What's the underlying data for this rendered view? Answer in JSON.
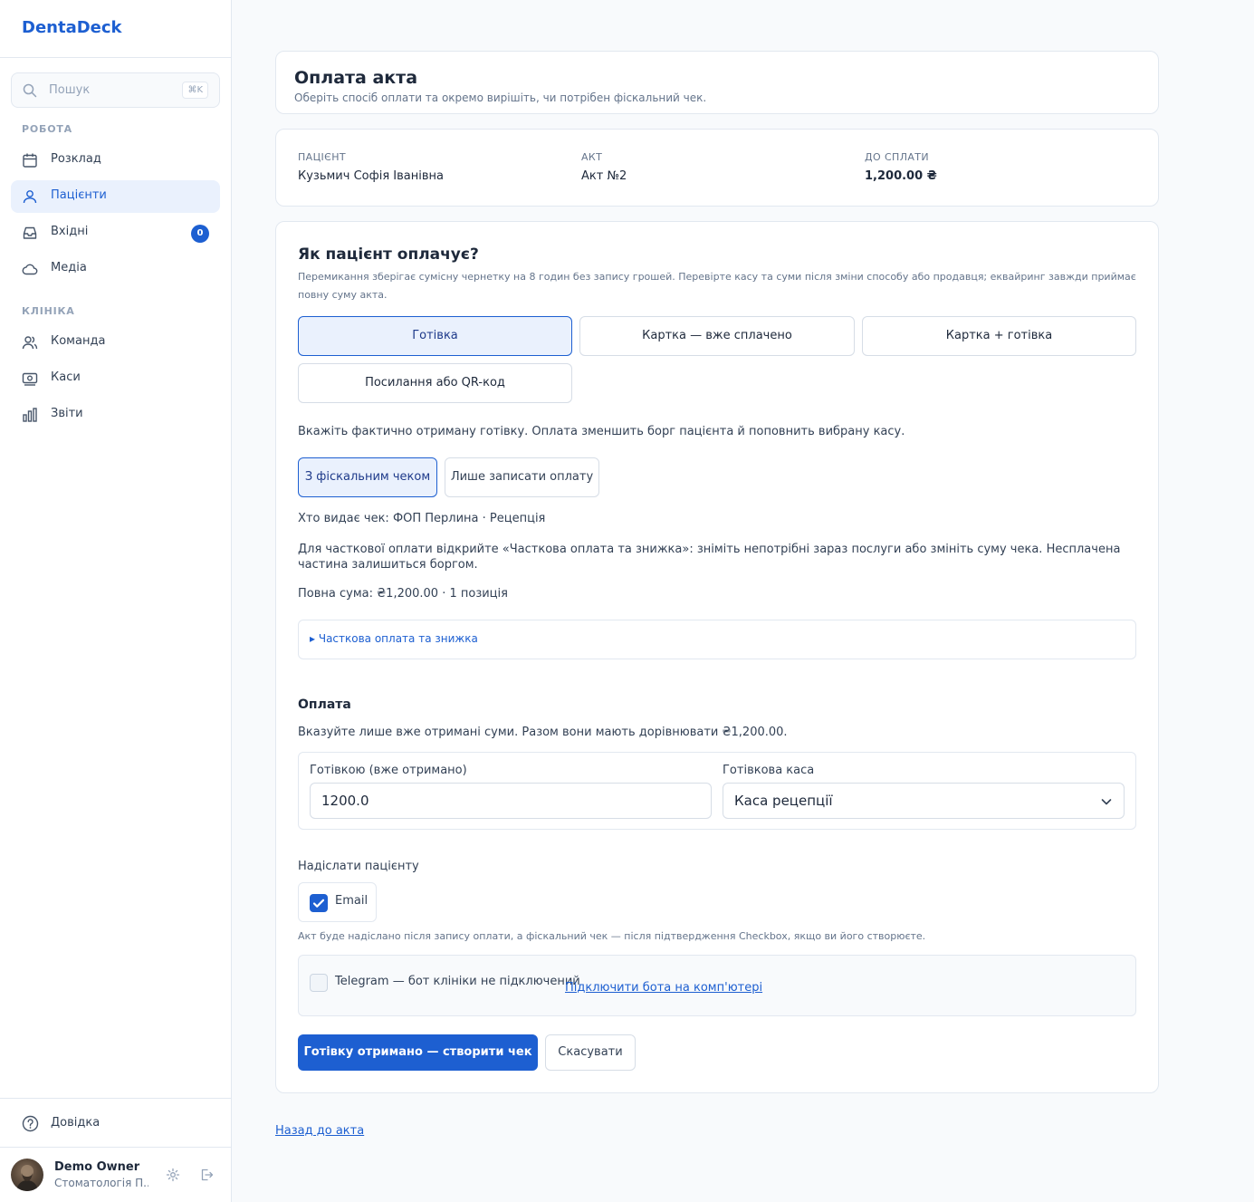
{
  "app": {
    "brand": "DentaDeck"
  },
  "sidebar": {
    "search": {
      "placeholder": "Пошук",
      "shortcut": "⌘K"
    },
    "groups": [
      {
        "label": "РОБОТА"
      },
      {
        "label": "КЛІНІКА"
      }
    ],
    "items": [
      {
        "label": "Розклад",
        "icon": "calendar-icon"
      },
      {
        "label": "Пацієнти",
        "icon": "users-icon",
        "active": true
      },
      {
        "label": "Вхідні",
        "icon": "inbox-icon",
        "badge": "0"
      },
      {
        "label": "Медіа",
        "icon": "cloud-icon"
      },
      {
        "label": "Команда",
        "icon": "team-icon"
      },
      {
        "label": "Каси",
        "icon": "cash-register-icon"
      },
      {
        "label": "Звіти",
        "icon": "bar-chart-icon"
      }
    ],
    "help": {
      "label": "Довідка",
      "icon": "help-circle-icon"
    },
    "user": {
      "name": "Demo Owner",
      "org": "Стоматологія П..."
    }
  },
  "header": {
    "title": "Оплата акта",
    "subtitle": "Оберіть спосіб оплати та окремо вирішіть, чи потрібен фіскальний чек."
  },
  "summary": {
    "patient_label": "ПАЦІЄНТ",
    "patient_value": "Кузьмич Софія Іванівна",
    "act_label": "АКТ",
    "act_value": "Акт №2",
    "due_label": "ДО СПЛАТИ",
    "due_value": "1,200.00 ₴"
  },
  "method": {
    "title": "Як пацієнт оплачує?",
    "hint": "Перемикання зберігає сумісну чернетку на 8 годин без запису грошей. Перевірте касу та суми після зміни способу або продавця; еквайринг завжди приймає повну суму акта.",
    "options": [
      {
        "label": "Готівка",
        "selected": true
      },
      {
        "label": "Картка — вже сплачено",
        "selected": false
      },
      {
        "label": "Картка + готівка",
        "selected": false
      },
      {
        "label": "Посилання або QR-код",
        "selected": false
      }
    ],
    "cash_note": "Вкажіть фактично отриману готівку. Оплата зменшить борг пацієнта й поповнить вибрану касу.",
    "receipt_options": [
      {
        "label": "З фіскальним чеком",
        "selected": true
      },
      {
        "label": "Лише записати оплату",
        "selected": false
      }
    ],
    "issuer": "Хто видає чек: ФОП Перлина · Рецепція",
    "partial_note": "Для часткової оплати відкрийте «Часткова оплата та знижка»: зніміть непотрібні зараз послуги або змініть суму чека. Несплачена частина залишиться боргом.",
    "full_sum": "Повна сума: ₴1,200.00 · 1 позиція",
    "details_label": "Часткова оплата та знижка"
  },
  "payment": {
    "title": "Оплата",
    "hint": "Вказуйте лише вже отримані суми. Разом вони мають дорівнювати ₴1,200.00.",
    "cash_label": "Готівкою (вже отримано)",
    "cash_value": "1200.0",
    "register_label": "Готівкова каса",
    "register_value": "Каса рецепції"
  },
  "send": {
    "title": "Надіслати пацієнту",
    "email_label": "Email",
    "email_checked": true,
    "note": "Акт буде надіслано після запису оплати, а фіскальний чек — після підтвердження Checkbox, якщо ви його створюєте.",
    "telegram_label": "Telegram — бот клініки не підключений",
    "telegram_checked": false,
    "telegram_link": "Підключити бота на комп'ютері"
  },
  "actions": {
    "primary": "Готівку отримано — створити чек",
    "cancel": "Скасувати",
    "back": "Назад до акта"
  },
  "colors": {
    "accent": "#1d5fd1",
    "selected_bg": "#eaf1fd"
  }
}
